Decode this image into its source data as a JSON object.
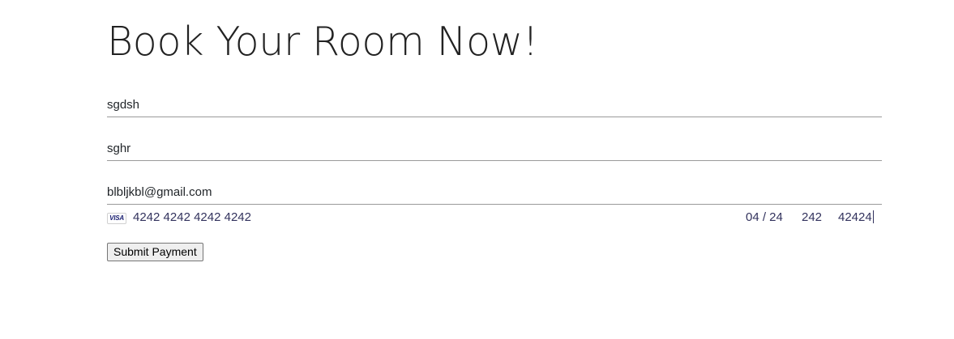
{
  "page": {
    "title": "Book Your Room Now!"
  },
  "form": {
    "first_name_value": "sgdsh",
    "last_name_value": "sghr",
    "email_value": "blbljkbl@gmail.com"
  },
  "card": {
    "brand": "VISA",
    "brand_icon": "visa-card-icon",
    "number": "4242 4242 4242 4242",
    "expiry": "04 / 24",
    "cvc": "242",
    "zip": "42424",
    "text_color": "#32325d",
    "brand_color": "#1a1f71"
  },
  "actions": {
    "submit_label": "Submit Payment"
  }
}
